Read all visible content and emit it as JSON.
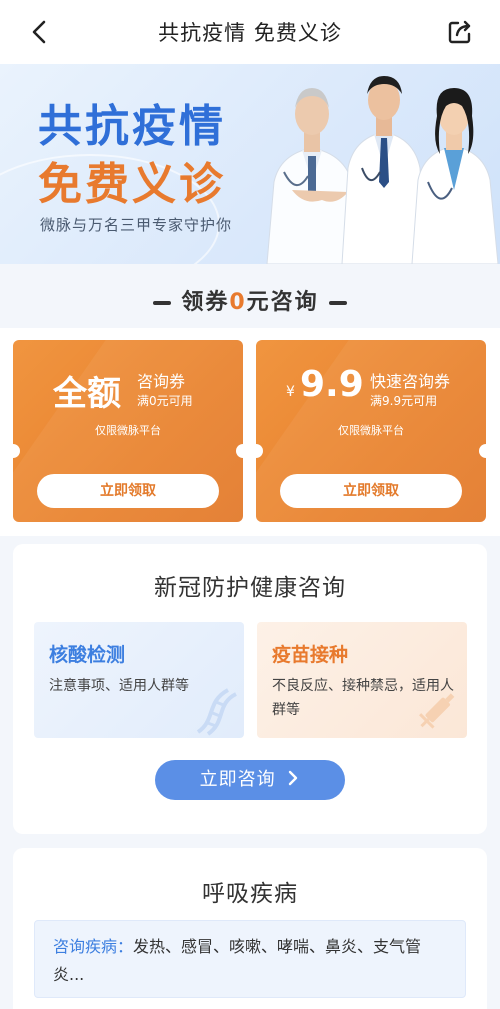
{
  "header": {
    "title": "共抗疫情 免费义诊",
    "back_icon": "chevron-left-icon",
    "share_icon": "share-icon"
  },
  "banner": {
    "title_line1": "共抗疫情",
    "title_line2": "免费义诊",
    "subtitle": "微脉与万名三甲专家守护你",
    "colors": {
      "title1": "#2f6fd8",
      "title2": "#e87a2e"
    }
  },
  "coupon_section": {
    "heading_prefix": "领券",
    "heading_zero": "0",
    "heading_suffix": "元咨询",
    "coupons": [
      {
        "amount": "全额",
        "name": "咨询券",
        "condition": "满0元可用",
        "limit": "仅限微脉平台",
        "button": "立即领取"
      },
      {
        "currency": "¥",
        "amount": "9.9",
        "name": "快速咨询券",
        "condition": "满9.9元可用",
        "limit": "仅限微脉平台",
        "button": "立即领取"
      }
    ],
    "accent_color": "#e9832f"
  },
  "covid_card": {
    "title": "新冠防护健康咨询",
    "tiles": [
      {
        "title": "核酸检测",
        "desc": "注意事项、适用人群等",
        "icon": "dna-icon"
      },
      {
        "title": "疫苗接种",
        "desc": "不良反应、接种禁忌，适用人群等",
        "icon": "syringe-icon"
      }
    ],
    "button": "立即咨询",
    "button_icon": "chevron-right-icon",
    "button_color": "#5b8fe6"
  },
  "respiratory_card": {
    "title": "呼吸疾病",
    "label": "咨询疾病：",
    "diseases": "发热、感冒、咳嗽、哮喘、鼻炎、支气管炎..."
  }
}
